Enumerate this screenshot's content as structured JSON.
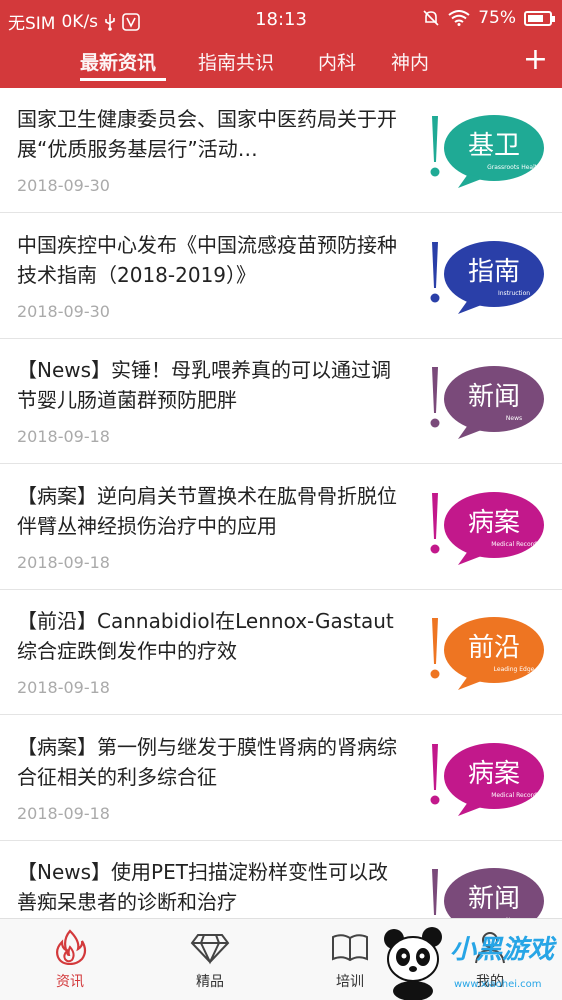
{
  "status_bar": {
    "carrier": "无SIM",
    "speed": "0K/s",
    "time": "18:13",
    "battery": "75%",
    "battery_level": 0.75
  },
  "tabs": [
    {
      "label": "最新资讯",
      "active": true
    },
    {
      "label": "指南共识",
      "active": false
    },
    {
      "label": "内科",
      "active": false
    },
    {
      "label": "神内",
      "active": false
    }
  ],
  "add_label": "+",
  "articles": [
    {
      "title": "国家卫生健康委员会、国家中医药局关于开展“优质服务基层行”活动…",
      "date": "2018-09-30",
      "badge_text": "基卫",
      "badge_sub": "Grassroots Health",
      "badge_color": "#1faa95",
      "mark_color": "#1faa95"
    },
    {
      "title": "中国疾控中心发布《中国流感疫苗预防接种技术指南（2018-2019）》",
      "date": "2018-09-30",
      "badge_text": "指南",
      "badge_sub": "Instruction",
      "badge_color": "#2a3fa8",
      "mark_color": "#2a3fa8"
    },
    {
      "title": "【News】实锤！母乳喂养真的可以通过调节婴儿肠道菌群预防肥胖",
      "date": "2018-09-18",
      "badge_text": "新闻",
      "badge_sub": "News",
      "badge_color": "#7a4a7a",
      "mark_color": "#7a4a7a"
    },
    {
      "title": "【病案】逆向肩关节置换术在肱骨骨折脱位伴臂丛神经损伤治疗中的应用",
      "date": "2018-09-18",
      "badge_text": "病案",
      "badge_sub": "Medical Record",
      "badge_color": "#c2188b",
      "mark_color": "#c2188b"
    },
    {
      "title": "【前沿】Cannabidiol在Lennox-Gastaut综合症跌倒发作中的疗效",
      "date": "2018-09-18",
      "badge_text": "前沿",
      "badge_sub": "Leading Edge",
      "badge_color": "#ee7522",
      "mark_color": "#ee7522"
    },
    {
      "title": "【病案】第一例与继发于膜性肾病的肾病综合征相关的利多综合征",
      "date": "2018-09-18",
      "badge_text": "病案",
      "badge_sub": "Medical Record",
      "badge_color": "#c2188b",
      "mark_color": "#c2188b"
    },
    {
      "title": "【News】使用PET扫描淀粉样变性可以改善痴呆患者的诊断和治疗",
      "date": "",
      "badge_text": "新闻",
      "badge_sub": "News",
      "badge_color": "#7a4a7a",
      "mark_color": "#7a4a7a"
    }
  ],
  "bottom_nav": [
    {
      "label": "资讯",
      "icon": "flame-icon",
      "active": true
    },
    {
      "label": "精品",
      "icon": "diamond-icon",
      "active": false
    },
    {
      "label": "培训",
      "icon": "book-icon",
      "active": false
    },
    {
      "label": "我的",
      "icon": "person-icon",
      "active": false
    }
  ],
  "watermark": {
    "text": "小黑游戏",
    "url": "www.xiaohei.com"
  },
  "colors": {
    "primary": "#d3393b",
    "text": "#222222",
    "date": "#aaaaaa"
  }
}
